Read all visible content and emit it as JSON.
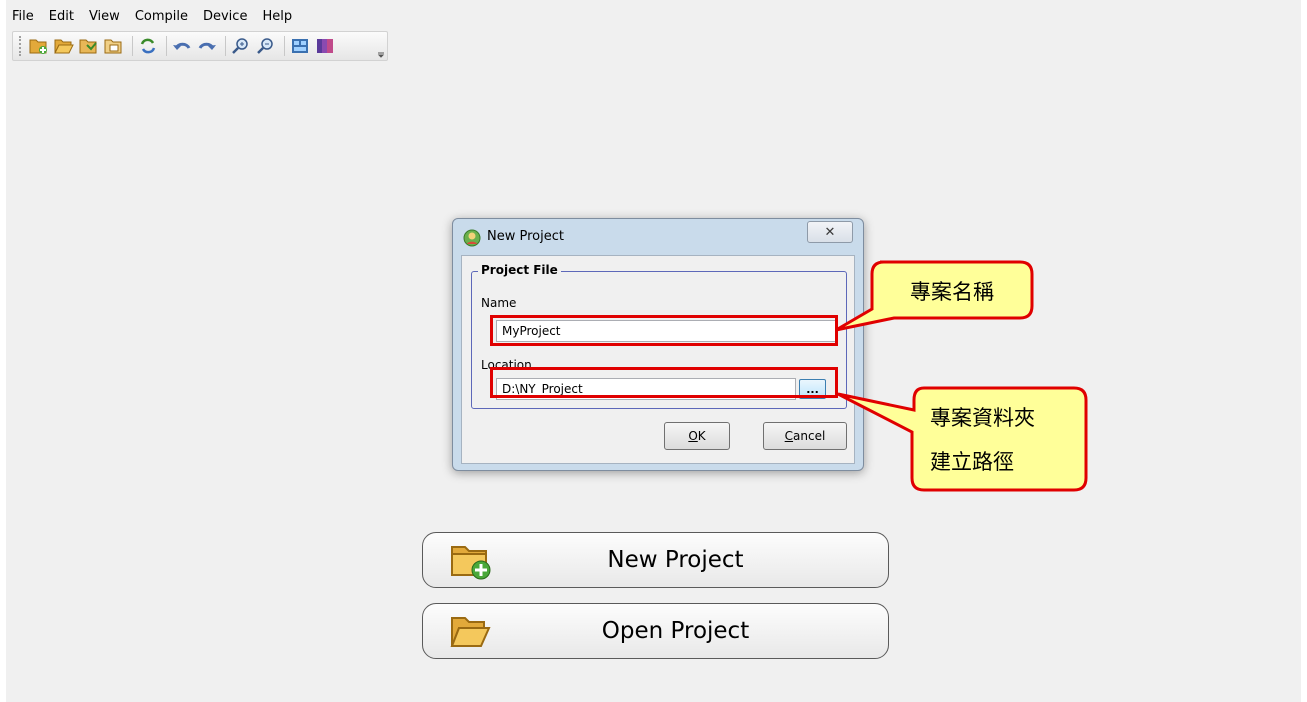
{
  "menu": [
    "File",
    "Edit",
    "View",
    "Compile",
    "Device",
    "Help"
  ],
  "toolbar": {
    "icons": [
      "new-project-icon",
      "open-folder-icon",
      "save-project-icon",
      "save-as-icon",
      "refresh-icon",
      "undo-icon",
      "redo-icon",
      "zoom-in-icon",
      "zoom-out-icon",
      "layout-icon",
      "color-icon"
    ]
  },
  "dialog": {
    "title": "New Project",
    "close_glyph": "✕",
    "group_title": "Project File",
    "name_label": "Name",
    "name_value": "MyProject",
    "location_label": "Location",
    "location_value": "D:\\NY_Project",
    "browse_label": "...",
    "ok_label": "OK",
    "ok_mnemonic": "O",
    "ok_rest": "K",
    "cancel_mnemonic": "C",
    "cancel_rest": "ancel"
  },
  "callouts": {
    "name_note": "專案名稱",
    "location_note_line1": "專案資料夾",
    "location_note_line2": "建立路徑"
  },
  "buttons": {
    "new_project": "New Project",
    "open_project": "Open Project"
  },
  "colors": {
    "highlight_red": "#e00000",
    "callout_fill": "#ffff99",
    "callout_border": "#e00000"
  }
}
